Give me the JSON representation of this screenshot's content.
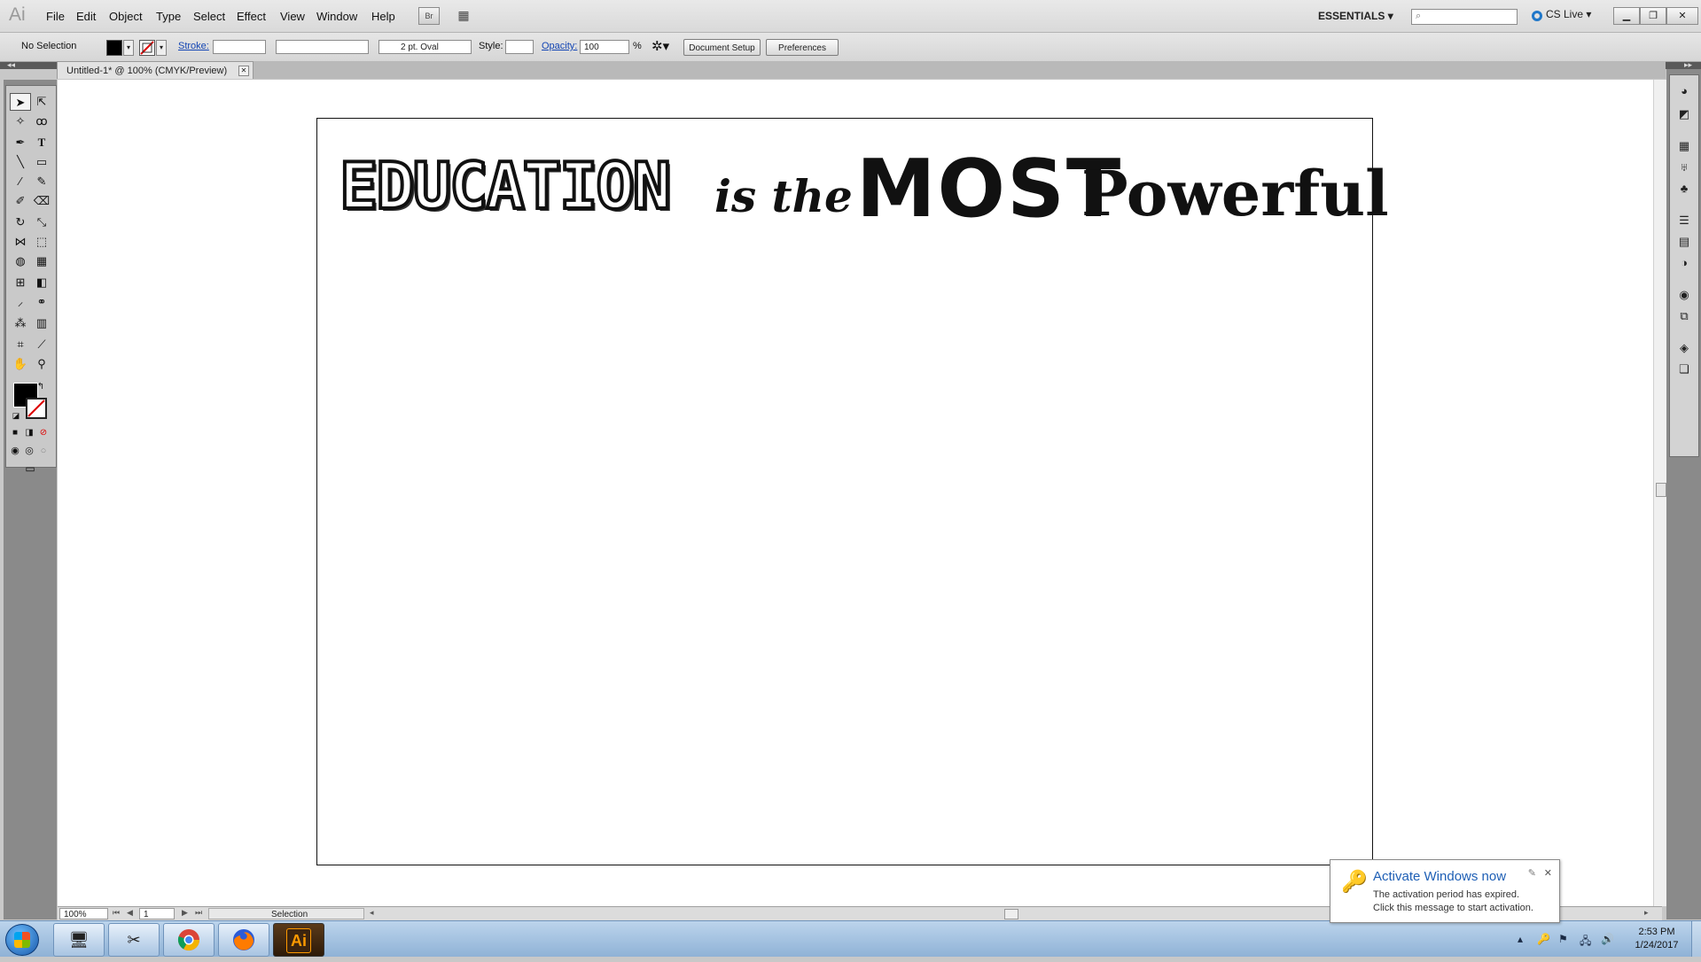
{
  "app": {
    "logo": "Ai"
  },
  "menu": [
    "File",
    "Edit",
    "Object",
    "Type",
    "Select",
    "Effect",
    "View",
    "Window",
    "Help"
  ],
  "menu_icons": {
    "bridge": "Br",
    "arrange": "▦"
  },
  "workspace": {
    "label": "ESSENTIALS",
    "cs_live": "CS Live"
  },
  "control": {
    "selection": "No Selection",
    "stroke_label": "Stroke:",
    "brush": "2 pt. Oval",
    "style_label": "Style:",
    "opacity_label": "Opacity:",
    "opacity_value": "100",
    "percent": "%",
    "doc_setup": "Document Setup",
    "preferences": "Preferences"
  },
  "doc_tab": {
    "title": "Untitled-1* @ 100% (CMYK/Preview)"
  },
  "artwork": {
    "word1": "EDUCATION",
    "word2": "is the",
    "word3": "MOST",
    "word4": "Powerful"
  },
  "status": {
    "zoom": "100%",
    "page": "1",
    "tool": "Selection"
  },
  "notification": {
    "title": "Activate Windows now",
    "line1": "The activation period has expired.",
    "line2": "Click this message to start activation."
  },
  "clock": {
    "time": "2:53 PM",
    "date": "1/24/2017"
  },
  "colors": {
    "accent": "#1f77c9",
    "link": "#1446b4",
    "ai_orange": "#ff9a00"
  }
}
